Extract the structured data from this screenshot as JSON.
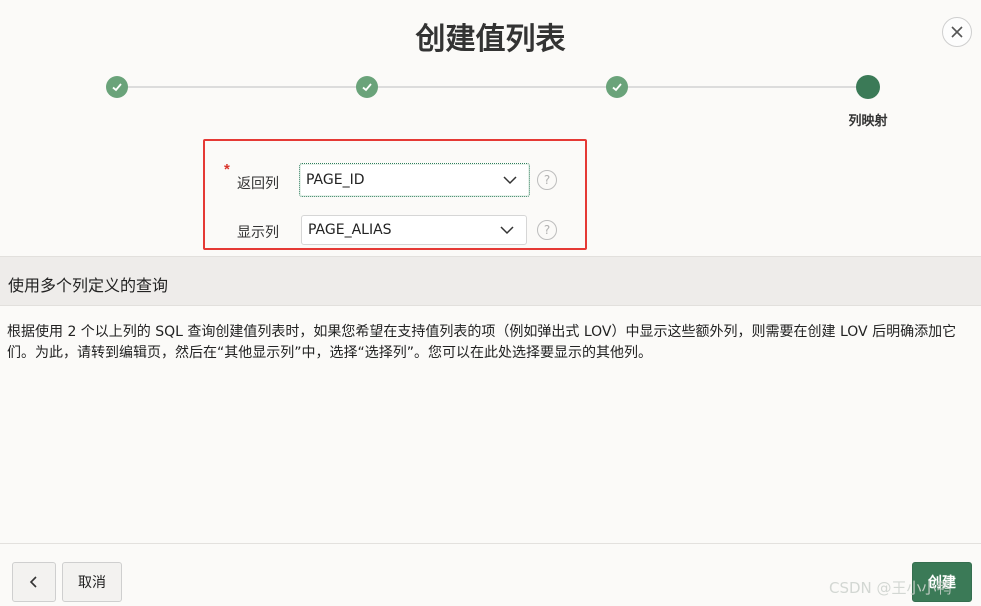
{
  "dialog": {
    "title": "创建值列表",
    "close_icon": "close-icon"
  },
  "wizard": {
    "steps": [
      {
        "state": "done",
        "icon": "check-icon"
      },
      {
        "state": "done",
        "icon": "check-icon"
      },
      {
        "state": "done",
        "icon": "check-icon"
      },
      {
        "state": "current",
        "label": "列映射"
      }
    ]
  },
  "form": {
    "return_column": {
      "label": "返回列",
      "required_mark": "*",
      "value": "PAGE_ID",
      "help": "?"
    },
    "display_column": {
      "label": "显示列",
      "value": "PAGE_ALIAS",
      "help": "?"
    }
  },
  "info": {
    "heading": "使用多个列定义的查询",
    "text": "根据使用 2 个以上列的 SQL 查询创建值列表时，如果您希望在支持值列表的项（例如弹出式 LOV）中显示这些额外列，则需要在创建 LOV 后明确添加它们。为此，请转到编辑页，然后在“其他显示列”中，选择“选择列”。您可以在此处选择要显示的其他列。"
  },
  "footer": {
    "back_icon": "chevron-left-icon",
    "cancel_label": "取消",
    "create_label": "创建"
  },
  "watermark": "CSDN @王小小鸭",
  "colors": {
    "accent": "#3b7a57",
    "step_done": "#6aa37a",
    "highlight": "#e53935",
    "required": "#d9342b"
  }
}
